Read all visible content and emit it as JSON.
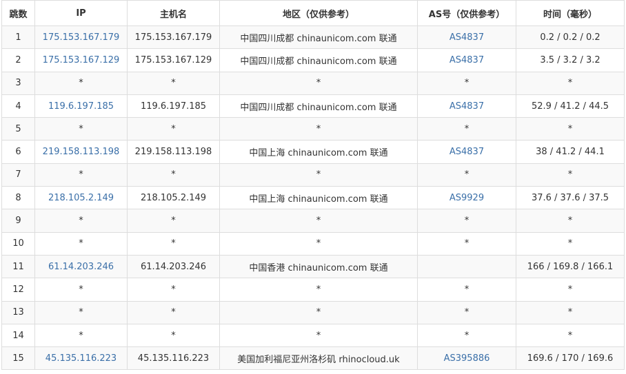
{
  "headers": {
    "hop": "跳数",
    "ip": "IP",
    "host": "主机名",
    "region": "地区（仅供参考）",
    "asn": "AS号（仅供参考）",
    "time": "时间（毫秒）"
  },
  "rows": [
    {
      "hop": "1",
      "ip": "175.153.167.179",
      "host": "175.153.167.179",
      "region": "中国四川成都 chinaunicom.com 联通",
      "asn": "AS4837",
      "time": "0.2 / 0.2 / 0.2"
    },
    {
      "hop": "2",
      "ip": "175.153.167.129",
      "host": "175.153.167.129",
      "region": "中国四川成都 chinaunicom.com 联通",
      "asn": "AS4837",
      "time": "3.5 / 3.2 / 3.2"
    },
    {
      "hop": "3",
      "ip": "*",
      "host": "*",
      "region": "*",
      "asn": "*",
      "time": "*"
    },
    {
      "hop": "4",
      "ip": "119.6.197.185",
      "host": "119.6.197.185",
      "region": "中国四川成都 chinaunicom.com 联通",
      "asn": "AS4837",
      "time": "52.9 / 41.2 / 44.5"
    },
    {
      "hop": "5",
      "ip": "*",
      "host": "*",
      "region": "*",
      "asn": "*",
      "time": "*"
    },
    {
      "hop": "6",
      "ip": "219.158.113.198",
      "host": "219.158.113.198",
      "region": "中国上海 chinaunicom.com 联通",
      "asn": "AS4837",
      "time": "38 / 41.2 / 44.1"
    },
    {
      "hop": "7",
      "ip": "*",
      "host": "*",
      "region": "*",
      "asn": "*",
      "time": "*"
    },
    {
      "hop": "8",
      "ip": "218.105.2.149",
      "host": "218.105.2.149",
      "region": "中国上海 chinaunicom.com 联通",
      "asn": "AS9929",
      "time": "37.6 / 37.6 / 37.5"
    },
    {
      "hop": "9",
      "ip": "*",
      "host": "*",
      "region": "*",
      "asn": "*",
      "time": "*"
    },
    {
      "hop": "10",
      "ip": "*",
      "host": "*",
      "region": "*",
      "asn": "*",
      "time": "*"
    },
    {
      "hop": "11",
      "ip": "61.14.203.246",
      "host": "61.14.203.246",
      "region": "中国香港 chinaunicom.com 联通",
      "asn": "",
      "time": "166 / 169.8 / 166.1"
    },
    {
      "hop": "12",
      "ip": "*",
      "host": "*",
      "region": "*",
      "asn": "*",
      "time": "*"
    },
    {
      "hop": "13",
      "ip": "*",
      "host": "*",
      "region": "*",
      "asn": "*",
      "time": "*"
    },
    {
      "hop": "14",
      "ip": "*",
      "host": "*",
      "region": "*",
      "asn": "*",
      "time": "*"
    },
    {
      "hop": "15",
      "ip": "45.135.116.223",
      "host": "45.135.116.223",
      "region": "美国加利福尼亚州洛杉矶 rhinocloud.uk",
      "asn": "AS395886",
      "time": "169.6 / 170 / 169.6"
    }
  ],
  "colors": {
    "link": "#3a6fa8",
    "border": "#dddddd",
    "stripe": "#f9f9f9"
  }
}
